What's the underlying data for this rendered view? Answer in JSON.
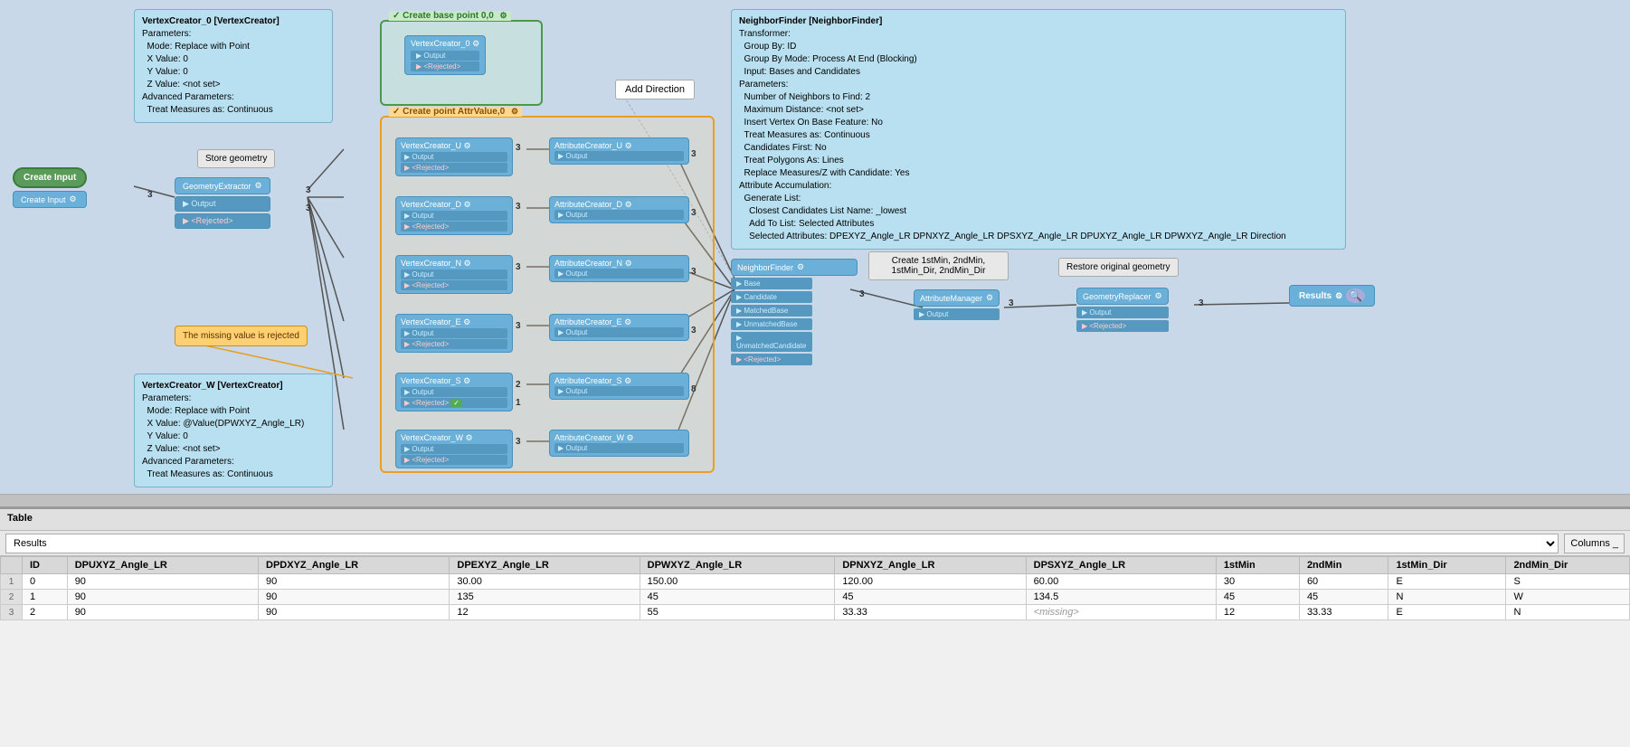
{
  "canvas": {
    "background": "#c8d8e8"
  },
  "infoBoxes": {
    "vertexCreator0": {
      "title": "VertexCreator_0 [VertexCreator]",
      "lines": [
        "Parameters:",
        "  Mode: Replace with Point",
        "  X Value: 0",
        "  Y Value: 0",
        "  Z Value: <not set>",
        "Advanced Parameters:",
        "  Treat Measures as: Continuous"
      ]
    },
    "neighborFinder": {
      "title": "NeighborFinder [NeighborFinder]",
      "lines": [
        "Transformer:",
        "  Group By: ID",
        "  Group By Mode: Process At End (Blocking)",
        "  Input: Bases and Candidates",
        "Parameters:",
        "  Number of Neighbors to Find: 2",
        "  Maximum Distance: <not set>",
        "  Insert Vertex On Base Feature: No",
        "  Treat Measures as: Continuous",
        "  Candidates First: No",
        "  Treat Polygons As: Lines",
        "  Replace Measures/Z with Candidate: Yes",
        "Attribute Accumulation:",
        "  Generate List:",
        "    Closest Candidates List Name: _lowest",
        "    Add To List: Selected Attributes",
        "    Selected Attributes: DPEXYZ_Angle_LR DPNXYZ_Angle_LR DPSXYZ_Angle_LR DPUXYZ_Angle_LR DPWXYZ_Angle_LR Direction"
      ]
    },
    "vertexCreatorW": {
      "title": "VertexCreator_W [VertexCreator]",
      "lines": [
        "Parameters:",
        "  Mode: Replace with Point",
        "  X Value: @Value(DPWXYZ_Angle_LR)",
        "  Y Value: 0",
        "  Z Value: <not set>",
        "Advanced Parameters:",
        "  Treat Measures as: Continuous"
      ]
    }
  },
  "groups": {
    "createBasePoint": "Create base point 0,0",
    "createPointAttr": "Create point AttrValue,0"
  },
  "nodes": {
    "createInput": "Create Input",
    "geometryExtractor": "GeometryExtractor",
    "vertexCreator0": "VertexCreator_0",
    "vertexCreatorU": "VertexCreator_U",
    "vertexCreatorD": "VertexCreator_D",
    "vertexCreatorN": "VertexCreator_N",
    "vertexCreatorE": "VertexCreator_E",
    "vertexCreatorS": "VertexCreator_S",
    "vertexCreatorW": "VertexCreator_W",
    "attributeCreatorU": "AttributeCreator_U",
    "attributeCreatorD": "AttributeCreator_D",
    "attributeCreatorN": "AttributeCreator_N",
    "attributeCreatorE": "AttributeCreator_E",
    "attributeCreatorS": "AttributeCreator_S",
    "attributeCreatorW": "AttributeCreator_W",
    "neighborFinder": "NeighborFinder",
    "attributeManager": "AttributeManager",
    "geometryReplacer": "GeometryReplacer",
    "results": "Results"
  },
  "labels": {
    "storeGeometry": "Store geometry",
    "restoreGeometry": "Restore original geometry",
    "createMins": "Create 1stMin, 2ndMin,\n1stMin_Dir, 2ndMin_Dir",
    "addDirection": "Add Direction",
    "missingValue": "The missing value is rejected",
    "table": "Table"
  },
  "ports": {
    "output": "Output",
    "rejected": "<Rejected>",
    "base": "Base",
    "candidate": "Candidate",
    "matchedBase": "MatchedBase",
    "unmatchedBase": "UnmatchedBase",
    "unmatchedCandidate": "UnmatchedCandidate"
  },
  "tableData": {
    "dropdown": "Results",
    "columnsBtn": "Columns _",
    "headers": [
      "ID",
      "DPUXYZ_Angle_LR",
      "DPDXYZ_Angle_LR",
      "DPEXYZ_Angle_LR",
      "DPWXYZ_Angle_LR",
      "DPNXYZ_Angle_LR",
      "DPSXYZ_Angle_LR",
      "1stMin",
      "2ndMin",
      "1stMin_Dir",
      "2ndMin_Dir"
    ],
    "rows": [
      [
        "1",
        "0",
        "90",
        "90",
        "30.00",
        "150.00",
        "120.00",
        "60.00",
        "30",
        "60",
        "E",
        "S"
      ],
      [
        "2",
        "1",
        "90",
        "90",
        "135",
        "45",
        "45",
        "134.5",
        "45",
        "45",
        "N",
        "W"
      ],
      [
        "3",
        "2",
        "90",
        "90",
        "12",
        "55",
        "33.33",
        "<missing>",
        "12",
        "33.33",
        "E",
        "N"
      ]
    ]
  }
}
